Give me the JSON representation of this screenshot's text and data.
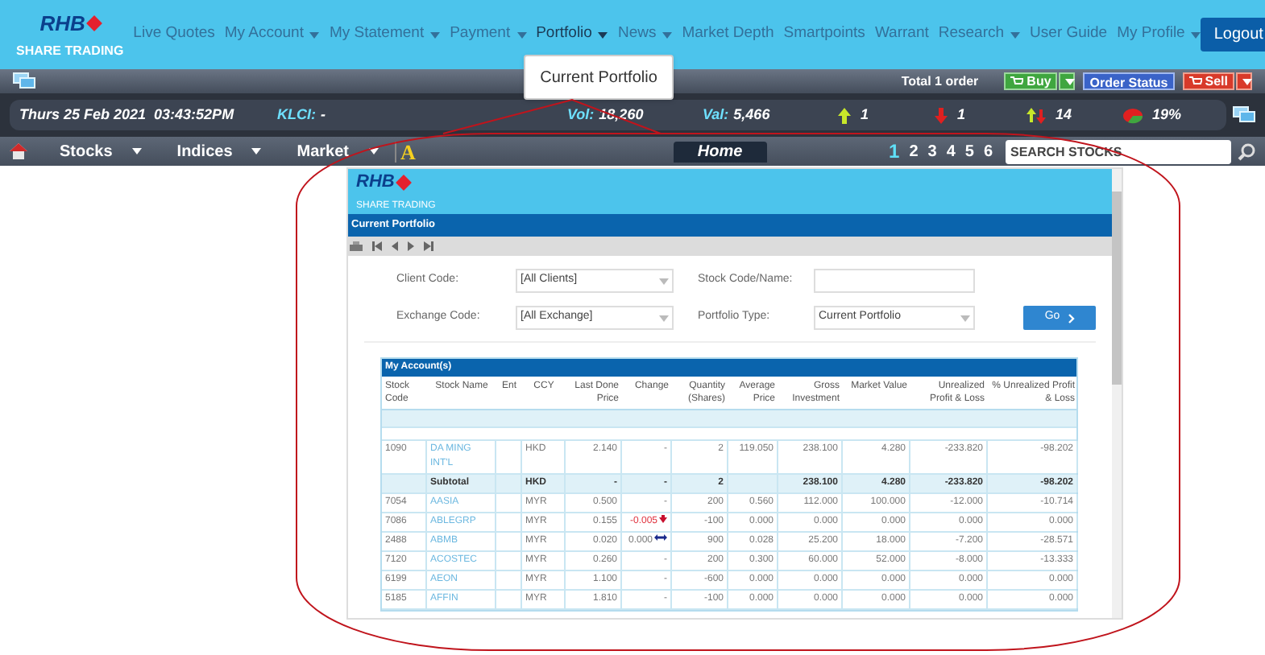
{
  "brand": {
    "logo": "RHB",
    "tagline": "SHARE TRADING"
  },
  "nav": [
    {
      "label": "Live Quotes",
      "has_menu": false,
      "selected": false
    },
    {
      "label": "My Account",
      "has_menu": true,
      "selected": false
    },
    {
      "label": "My Statement",
      "has_menu": true,
      "selected": false
    },
    {
      "label": "Payment",
      "has_menu": true,
      "selected": false
    },
    {
      "label": "Portfolio",
      "has_menu": true,
      "selected": true
    },
    {
      "label": "News",
      "has_menu": true,
      "selected": false
    },
    {
      "label": "Market Depth",
      "has_menu": false,
      "selected": false
    },
    {
      "label": "Smartpoints",
      "has_menu": false,
      "selected": false
    },
    {
      "label": "Warrant",
      "has_menu": false,
      "selected": false
    },
    {
      "label": "Research",
      "has_menu": true,
      "selected": false
    },
    {
      "label": "User Guide",
      "has_menu": false,
      "selected": false
    },
    {
      "label": "My Profile",
      "has_menu": true,
      "selected": false
    }
  ],
  "logout": "Logout",
  "dropdown": {
    "items": [
      "Current Portfolio"
    ]
  },
  "order_bar": {
    "total": "Total 1 order",
    "buy": "Buy",
    "order_status": "Order Status",
    "sell": "Sell"
  },
  "ticker": {
    "datetime": "Thurs 25 Feb 2021  03:43:52PM",
    "klci_label": "KLCI:",
    "klci": "-",
    "vol_label": "Vol:",
    "vol": "18,260",
    "val_label": "Val:",
    "val": "5,466",
    "up": "1",
    "down": "1",
    "unchanged": "14",
    "percent": "19%"
  },
  "menu_bar": {
    "menus": [
      "Stocks",
      "Indices",
      "Market"
    ],
    "font_tool": "A",
    "home_tab": "Home",
    "pages": [
      {
        "label": "1",
        "selected": true
      },
      {
        "label": "2",
        "selected": false
      },
      {
        "label": "3",
        "selected": false
      },
      {
        "label": "4",
        "selected": false
      },
      {
        "label": "5",
        "selected": false
      },
      {
        "label": "6",
        "selected": false
      }
    ],
    "search": {
      "placeholder": "SEARCH STOCKS"
    }
  },
  "portfolio_window": {
    "logo": "RHB",
    "tagline": "SHARE TRADING",
    "title": "Current Portfolio",
    "form": {
      "client_code": {
        "label": "Client Code:",
        "value": "[All Clients]"
      },
      "stock_code": {
        "label": "Stock Code/Name:"
      },
      "exchange_code": {
        "label": "Exchange Code:",
        "value": "[All Exchange]"
      },
      "portfolio_type": {
        "label": "Portfolio Type:",
        "value": "Current Portfolio"
      },
      "go": "Go"
    },
    "table": {
      "title": "My Account(s)",
      "columns": [
        "Stock Code",
        "Stock Name",
        "Ent",
        "CCY",
        "Last Done Price",
        "Change",
        "Quantity (Shares)",
        "Average Price",
        "Gross Investment",
        "Market Value",
        "Unrealized Profit & Loss",
        "% Unrealized Profit & Loss"
      ],
      "rows": [
        {
          "kind": "data",
          "code": "1090",
          "name": "DA MING INT'L",
          "ccy": "HKD",
          "last": "2.140",
          "change": {
            "text": "-",
            "kind": "none"
          },
          "qty": "2",
          "avg": "119.050",
          "gross": "238.100",
          "market": "4.280",
          "upl": "-233.820",
          "upl_pct": "-98.202"
        },
        {
          "kind": "subtotal",
          "name": "Subtotal",
          "ccy": "HKD",
          "last": "-",
          "change": {
            "text": "-",
            "kind": "none"
          },
          "qty": "2",
          "gross": "238.100",
          "market": "4.280",
          "upl": "-233.820",
          "upl_pct": "-98.202"
        },
        {
          "kind": "data",
          "code": "7054",
          "name": "AASIA",
          "ccy": "MYR",
          "last": "0.500",
          "change": {
            "text": "-",
            "kind": "none"
          },
          "qty": "200",
          "avg": "0.560",
          "gross": "112.000",
          "market": "100.000",
          "upl": "-12.000",
          "upl_pct": "-10.714"
        },
        {
          "kind": "data",
          "code": "7086",
          "name": "ABLEGRP",
          "ccy": "MYR",
          "last": "0.155",
          "change": {
            "text": "-0.005",
            "kind": "down"
          },
          "qty": "-100",
          "avg": "0.000",
          "gross": "0.000",
          "market": "0.000",
          "upl": "0.000",
          "upl_pct": "0.000"
        },
        {
          "kind": "data",
          "code": "2488",
          "name": "ABMB",
          "ccy": "MYR",
          "last": "0.020",
          "change": {
            "text": "0.000",
            "kind": "flat"
          },
          "qty": "900",
          "avg": "0.028",
          "gross": "25.200",
          "market": "18.000",
          "upl": "-7.200",
          "upl_pct": "-28.571"
        },
        {
          "kind": "data",
          "code": "7120",
          "name": "ACOSTEC",
          "ccy": "MYR",
          "last": "0.260",
          "change": {
            "text": "-",
            "kind": "none"
          },
          "qty": "200",
          "avg": "0.300",
          "gross": "60.000",
          "market": "52.000",
          "upl": "-8.000",
          "upl_pct": "-13.333"
        },
        {
          "kind": "data",
          "code": "6199",
          "name": "AEON",
          "ccy": "MYR",
          "last": "1.100",
          "change": {
            "text": "-",
            "kind": "none"
          },
          "qty": "-600",
          "avg": "0.000",
          "gross": "0.000",
          "market": "0.000",
          "upl": "0.000",
          "upl_pct": "0.000"
        },
        {
          "kind": "data",
          "code": "5185",
          "name": "AFFIN",
          "ccy": "MYR",
          "last": "1.810",
          "change": {
            "text": "-",
            "kind": "none"
          },
          "qty": "-100",
          "avg": "0.000",
          "gross": "0.000",
          "market": "0.000",
          "upl": "0.000",
          "upl_pct": "0.000"
        }
      ]
    }
  }
}
